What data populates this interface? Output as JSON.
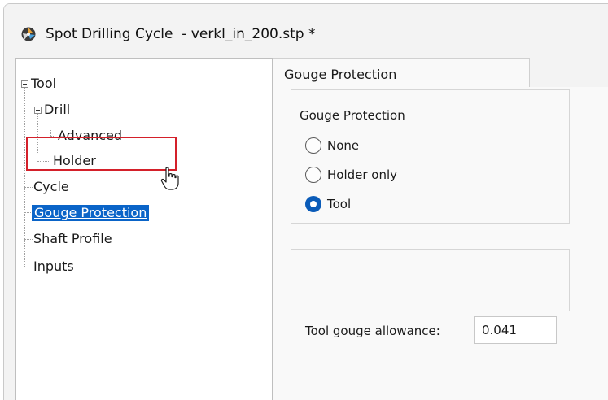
{
  "window": {
    "title": "Spot Drilling Cycle  - verkl_in_200.stp *"
  },
  "tree": {
    "items": [
      {
        "label": "Tool"
      },
      {
        "label": "Drill"
      },
      {
        "label": "Advanced"
      },
      {
        "label": "Holder"
      },
      {
        "label": "Cycle"
      },
      {
        "label": "Gouge Protection",
        "selected": true
      },
      {
        "label": "Shaft Profile"
      },
      {
        "label": "Inputs"
      }
    ]
  },
  "tabs": [
    {
      "label": "Gouge Protection",
      "active": true
    }
  ],
  "gouge_group": {
    "caption": "Gouge Protection",
    "options": [
      {
        "label": "None",
        "checked": false
      },
      {
        "label": "Holder only",
        "checked": false
      },
      {
        "label": "Tool",
        "checked": true
      }
    ]
  },
  "allowance": {
    "label": "Tool gouge allowance:",
    "value": "0.041"
  },
  "colors": {
    "selection": "#0a64c8",
    "highlight_box": "#d4202a",
    "radio_checked": "#0a5bb8"
  },
  "icons": {
    "app": "drill-app-icon",
    "cursor": "hand-pointer-icon"
  }
}
